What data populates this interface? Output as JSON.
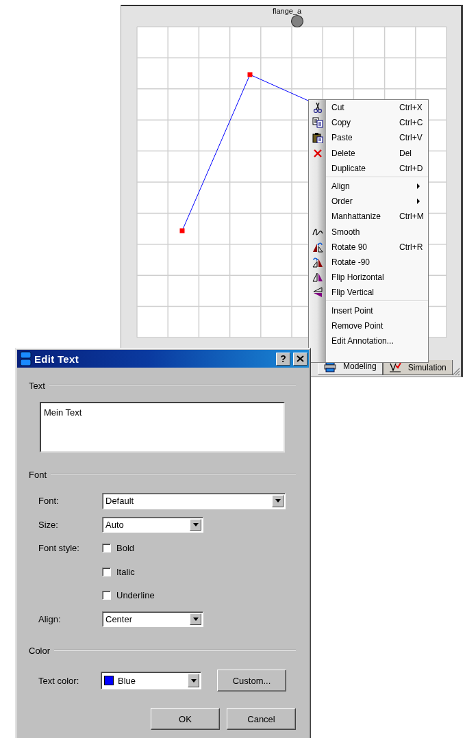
{
  "canvas_window": {
    "port_label": "flange_a",
    "tabs": [
      {
        "label": "Modeling",
        "selected": true
      },
      {
        "label": "Simulation",
        "selected": false
      }
    ]
  },
  "context_menu": {
    "groups": [
      {
        "items": [
          {
            "label": "Cut",
            "shortcut": "Ctrl+X",
            "submenu": false
          },
          {
            "label": "Copy",
            "shortcut": "Ctrl+C",
            "submenu": false
          },
          {
            "label": "Paste",
            "shortcut": "Ctrl+V",
            "submenu": false
          },
          {
            "label": "Delete",
            "shortcut": "Del",
            "submenu": false
          },
          {
            "label": "Duplicate",
            "shortcut": "Ctrl+D",
            "submenu": false
          }
        ]
      },
      {
        "items": [
          {
            "label": "Align",
            "submenu": true
          },
          {
            "label": "Order",
            "submenu": true
          },
          {
            "label": "Manhattanize",
            "shortcut": "Ctrl+M",
            "submenu": false
          },
          {
            "label": "Smooth",
            "submenu": false
          },
          {
            "label": "Rotate 90",
            "shortcut": "Ctrl+R",
            "submenu": false
          },
          {
            "label": "Rotate -90",
            "submenu": false
          },
          {
            "label": "Flip Horizontal",
            "submenu": false
          },
          {
            "label": "Flip Vertical",
            "submenu": false
          }
        ]
      },
      {
        "items": [
          {
            "label": "Insert Point",
            "submenu": false
          },
          {
            "label": "Remove Point",
            "submenu": false
          },
          {
            "label": "Edit Annotation...",
            "submenu": false
          }
        ]
      }
    ]
  },
  "dialog": {
    "title": "Edit Text",
    "help_button": "?",
    "text_section": {
      "heading": "Text",
      "value": "Mein Text"
    },
    "font_section": {
      "heading": "Font",
      "font": {
        "label": "Font:",
        "value": "Default"
      },
      "size": {
        "label": "Size:",
        "value": "Auto"
      },
      "style_label": "Font style:",
      "styles": [
        {
          "label": "Bold",
          "checked": false
        },
        {
          "label": "Italic",
          "checked": false
        },
        {
          "label": "Underline",
          "checked": false
        }
      ],
      "align": {
        "label": "Align:",
        "value": "Center"
      }
    },
    "color_section": {
      "heading": "Color",
      "label": "Text color:",
      "value": "Blue",
      "color": "#0000ff",
      "custom_button": "Custom..."
    },
    "buttons": [
      "OK",
      "Cancel"
    ]
  }
}
